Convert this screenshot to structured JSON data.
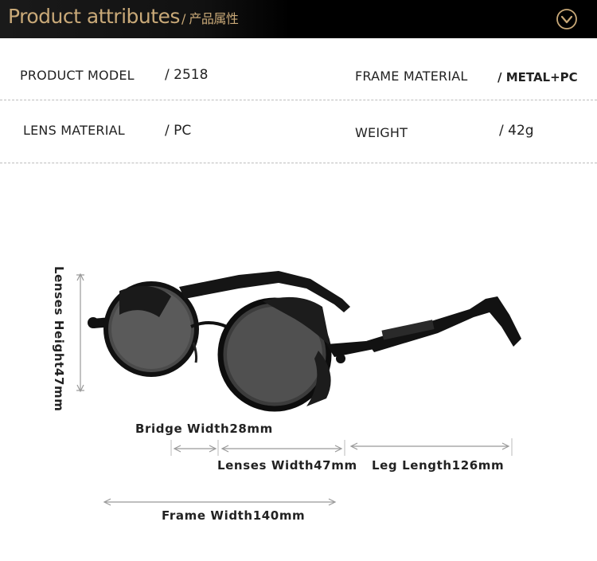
{
  "header": {
    "title": "Product attributes",
    "subtitle": "/ 产品属性"
  },
  "attributes": [
    {
      "label": "PRODUCT MODEL",
      "value": "/ 2518"
    },
    {
      "label": "FRAME MATERIAL",
      "value": "/  METAL+PC"
    },
    {
      "label": "LENS MATERIAL",
      "value": "/ PC"
    },
    {
      "label": "WEIGHT",
      "value": "/ 42g"
    }
  ],
  "dimensions": {
    "lenses_height": "Lenses Height47mm",
    "bridge_width": "Bridge Width28mm",
    "lenses_width": "Lenses Width47mm",
    "leg_length": "Leg Length126mm",
    "frame_width": "Frame Width140mm"
  },
  "colors": {
    "header_bg": "#000000",
    "header_text": "#c9a978",
    "dim_line": "#999999"
  },
  "icons": {
    "header": "chevron-down-circle-icon"
  }
}
